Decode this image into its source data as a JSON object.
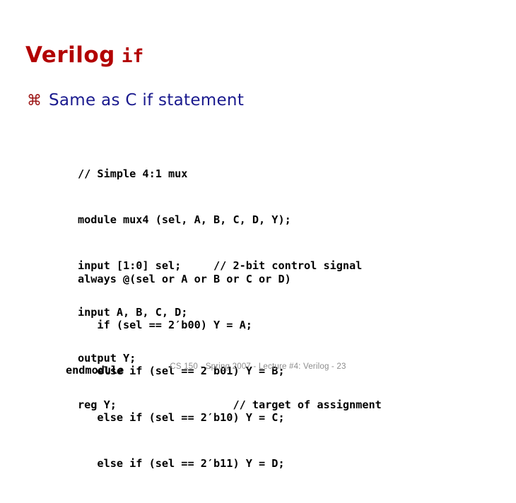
{
  "slide": {
    "title_main": "Verilog",
    "title_code": "if",
    "title_color": "#B20000",
    "background_color": "#FFFFFF"
  },
  "bullet": {
    "glyph": "⌘",
    "glyph_name": "place-of-interest-bullet",
    "glyph_color": "#9C1414",
    "text": "Same as C if statement",
    "text_color": "#1A1A8E"
  },
  "code": {
    "color": "#000000",
    "declaration_lines": [
      "// Simple 4:1 mux",
      "module mux4 (sel, A, B, C, D, Y);",
      "input [1:0] sel;     // 2-bit control signal",
      "input A, B, C, D;",
      "output Y;",
      "reg Y;                  // target of assignment"
    ],
    "always_lines": [
      "always @(sel or A or B or C or D)",
      "   if (sel == 2′b00) Y = A;",
      "   else if (sel == 2′b01) Y = B;",
      "   else if (sel == 2′b10) Y = C;",
      "   else if (sel == 2′b11) Y = D;"
    ],
    "end_lines": [
      "endmodule"
    ]
  },
  "footer": {
    "text": "CS 150 - Spring 2007 - Lecture #4: Verilog - 23",
    "color": "#8C8C8C"
  }
}
